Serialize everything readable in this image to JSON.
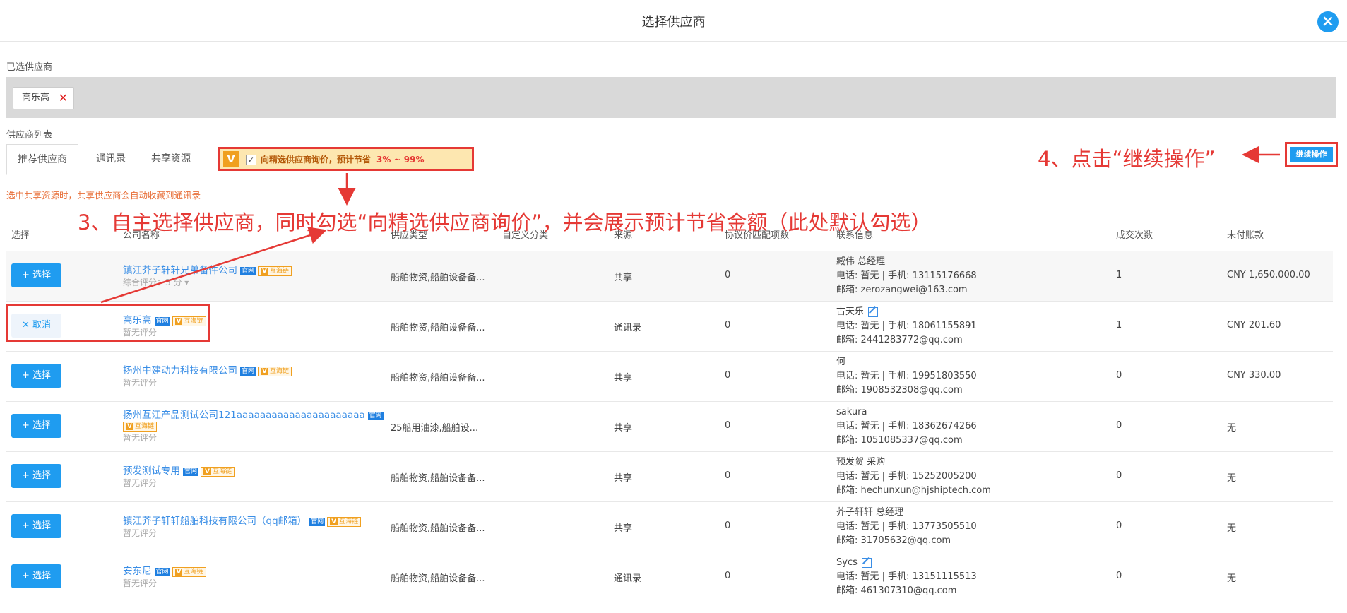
{
  "header": {
    "title": "选择供应商"
  },
  "selected": {
    "label": "已选供应商",
    "chips": [
      "高乐高"
    ]
  },
  "list_label": "供应商列表",
  "tabs": [
    "推荐供应商",
    "通讯录",
    "共享资源"
  ],
  "vip_option": {
    "logo": "V",
    "checkbox": "✓",
    "text": "向精选供应商询价，预计节省",
    "saving": "3% ~ 99%"
  },
  "note": "选中共享资源时，共享供应商会自动收藏到通讯录",
  "annotations": {
    "step3": "3、自主选择供应商，同时勾选“向精选供应商询价”，并会展示预计节省金额（此处默认勾选）",
    "step4": "4、点击“继续操作”"
  },
  "continue_button": "继续操作",
  "columns": [
    "选择",
    "公司名称",
    "供应类型",
    "自定义分类",
    "来源",
    "协议价匹配项数",
    "联系信息",
    "成交次数",
    "未付账款"
  ],
  "badges": {
    "official": "官网",
    "partner": "互海链",
    "v": "V"
  },
  "buttons": {
    "select": "+ 选择",
    "cancel": "✕ 取消"
  },
  "rows": [
    {
      "action": "select",
      "company": "镇江芥子轩轩兄弟备件公司",
      "rating": "综合评分：3 分",
      "type": "船舶物资,船舶设备备...",
      "source": "共享",
      "match": "0",
      "contact_name": "臧伟 总经理",
      "phone": "电话: 暂无 | 手机: 13115176668",
      "email": "邮箱: zerozangwei@163.com",
      "deals": "1",
      "unpaid": "CNY  1,650,000.00"
    },
    {
      "action": "cancel",
      "company": "高乐高",
      "rating": "暂无评分",
      "type": "船舶物资,船舶设备备...",
      "source": "通讯录",
      "match": "0",
      "contact_name": "古天乐",
      "phone": "电话: 暂无 | 手机: 18061155891",
      "email": "邮箱: 2441283772@qq.com",
      "deals": "1",
      "unpaid": "CNY  201.60"
    },
    {
      "action": "select",
      "company": "扬州中建动力科技有限公司",
      "rating": "暂无评分",
      "type": "船舶物资,船舶设备备...",
      "source": "共享",
      "match": "0",
      "contact_name": "何",
      "phone": "电话: 暂无 | 手机: 19951803550",
      "email": "邮箱: 1908532308@qq.com",
      "deals": "0",
      "unpaid": "CNY  330.00"
    },
    {
      "action": "select",
      "company": "扬州互江产品测试公司121aaaaaaaaaaaaaaaaaaaaaa",
      "rating": "暂无评分",
      "type": "25船用油漆,船舶设...",
      "source": "共享",
      "match": "0",
      "contact_name": "sakura",
      "phone": "电话: 暂无 | 手机: 18362674266",
      "email": "邮箱: 1051085337@qq.com",
      "deals": "0",
      "unpaid": "无"
    },
    {
      "action": "select",
      "company": "预发测试专用",
      "rating": "暂无评分",
      "type": "船舶物资,船舶设备备...",
      "source": "共享",
      "match": "0",
      "contact_name": "预发贺 采购",
      "phone": "电话: 暂无 | 手机: 15252005200",
      "email": "邮箱: hechunxun@hjshiptech.com",
      "deals": "0",
      "unpaid": "无"
    },
    {
      "action": "select",
      "company": "镇江芥子轩轩船舶科技有限公司（qq邮箱）",
      "rating": "暂无评分",
      "type": "船舶物资,船舶设备备...",
      "source": "共享",
      "match": "0",
      "contact_name": "芥子轩轩 总经理",
      "phone": "电话: 暂无 | 手机: 13773505510",
      "email": "邮箱: 31705632@qq.com",
      "deals": "0",
      "unpaid": "无"
    },
    {
      "action": "select",
      "company": "安东尼",
      "rating": "暂无评分",
      "type": "船舶物资,船舶设备备...",
      "source": "通讯录",
      "match": "0",
      "contact_name": "Sycs",
      "phone": "电话: 暂无 | 手机: 13151115513",
      "email": "邮箱: 461307310@qq.com",
      "deals": "0",
      "unpaid": "无"
    }
  ]
}
